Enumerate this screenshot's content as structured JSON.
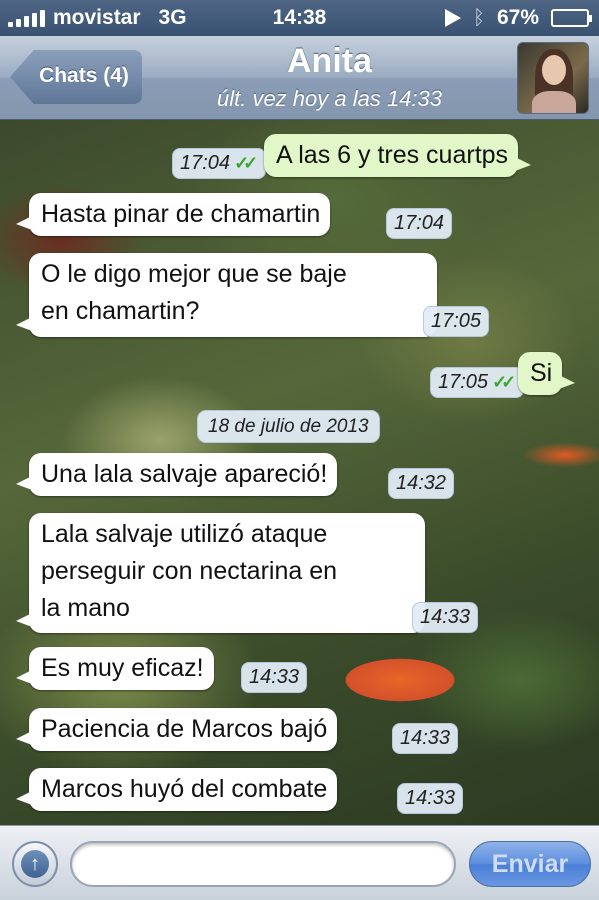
{
  "status_bar": {
    "carrier": "movistar",
    "network": "3G",
    "time": "14:38",
    "battery": "67%",
    "battery_level": 0.67
  },
  "nav": {
    "back_label": "Chats (4)",
    "title": "Anita",
    "subtitle": "últ. vez hoy a las 14:33"
  },
  "messages": [
    {
      "direction": "out",
      "text": "A las 6 y tres cuartps",
      "time": "17:04",
      "read": true
    },
    {
      "direction": "in",
      "text": "Hasta pinar de chamartin",
      "time": "17:04"
    },
    {
      "direction": "in",
      "lines": [
        "O le digo mejor que se baje",
        "en chamartin?"
      ],
      "time": "17:05"
    },
    {
      "direction": "out",
      "text": "Si",
      "time": "17:05",
      "read": true
    },
    {
      "direction": "in",
      "text": "Una lala salvaje apareció!",
      "time": "14:32"
    },
    {
      "direction": "in",
      "lines": [
        "Lala salvaje utilizó ataque",
        "perseguir con nectarina en",
        "la mano"
      ],
      "time": "14:33"
    },
    {
      "direction": "in",
      "text": "Es muy eficaz!",
      "time": "14:33"
    },
    {
      "direction": "in",
      "text": "Paciencia de Marcos bajó",
      "time": "14:33"
    },
    {
      "direction": "in",
      "text": "Marcos huyó del combate",
      "time": "14:33"
    }
  ],
  "date_separator": "18 de julio de 2013",
  "input_bar": {
    "placeholder": "",
    "send_label": "Enviar"
  },
  "colors": {
    "outgoing_bubble": "#e1f7c8",
    "incoming_bubble": "#ffffff",
    "read_check": "#39a82a",
    "nav_bar": "#8c9eb7"
  }
}
